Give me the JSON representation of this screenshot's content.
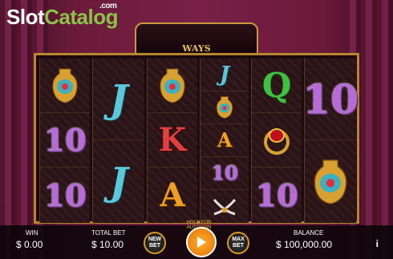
{
  "logo": {
    "part1": "Slot",
    "part2": "Catalog",
    "com": ".com"
  },
  "banner": {
    "title": "WAYS"
  },
  "reels": [
    [
      "vase",
      "10",
      "10"
    ],
    [
      "J",
      "J"
    ],
    [
      "vase",
      "K",
      "A"
    ],
    [
      "J",
      "vase",
      "A",
      "10",
      "swords"
    ],
    [
      "Q",
      "ring",
      "10"
    ],
    [
      "10",
      "",
      "vase"
    ]
  ],
  "bottom": {
    "win_label": "WIN",
    "win_value": "$ 0.00",
    "total_bet_label": "TOTAL BET",
    "total_bet_value": "$ 10.00",
    "new_bet": "NEW BET",
    "hold": "HOLD FOR AUTOSPIN",
    "max_bet": "MAX BET",
    "balance_label": "BALANCE",
    "balance_value": "$ 100,000.00",
    "info": "i"
  }
}
